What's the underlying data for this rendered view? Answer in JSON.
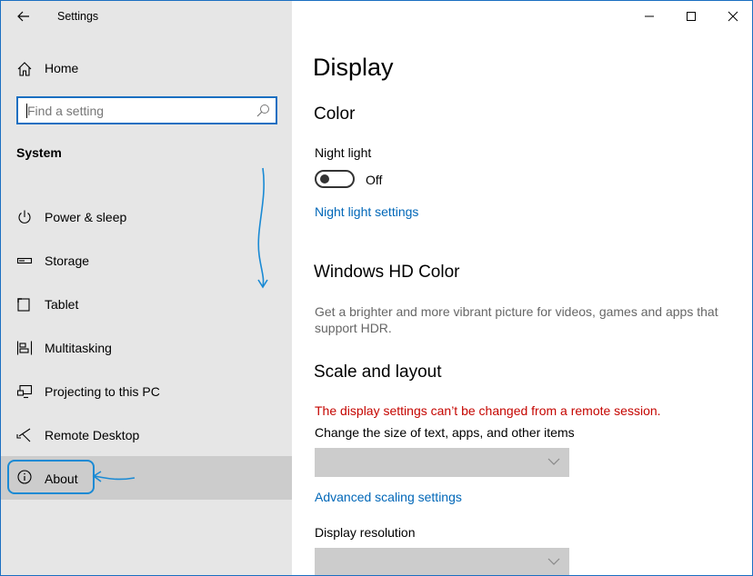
{
  "window": {
    "title": "Settings",
    "controls": [
      "minimize",
      "maximize",
      "close"
    ]
  },
  "sidebar": {
    "home_label": "Home",
    "search_placeholder": "Find a setting",
    "section_title": "System",
    "items": [
      {
        "label": "Power & sleep",
        "icon": "power-icon"
      },
      {
        "label": "Storage",
        "icon": "storage-icon"
      },
      {
        "label": "Tablet",
        "icon": "tablet-icon"
      },
      {
        "label": "Multitasking",
        "icon": "multitasking-icon"
      },
      {
        "label": "Projecting to this PC",
        "icon": "projecting-icon"
      },
      {
        "label": "Remote Desktop",
        "icon": "remote-desktop-icon"
      },
      {
        "label": "About",
        "icon": "info-icon",
        "selected": true
      }
    ]
  },
  "main": {
    "page_title": "Display",
    "color": {
      "heading": "Color",
      "night_light_label": "Night light",
      "night_light_state": "Off",
      "night_light_link": "Night light settings"
    },
    "hd_color": {
      "heading": "Windows HD Color",
      "description": "Get a brighter and more vibrant picture for videos, games and apps that support HDR."
    },
    "scale": {
      "heading": "Scale and layout",
      "warning": "The display settings can’t be changed from a remote session.",
      "size_label": "Change the size of text, apps, and other items",
      "size_value": "",
      "advanced_link": "Advanced scaling settings",
      "resolution_label": "Display resolution",
      "resolution_value": ""
    }
  },
  "colors": {
    "accent": "#0067b8",
    "warning": "#c50500",
    "sidebar_bg": "#e6e6e6",
    "selected_bg": "#cccccc",
    "annotation": "#1a8ad4"
  }
}
